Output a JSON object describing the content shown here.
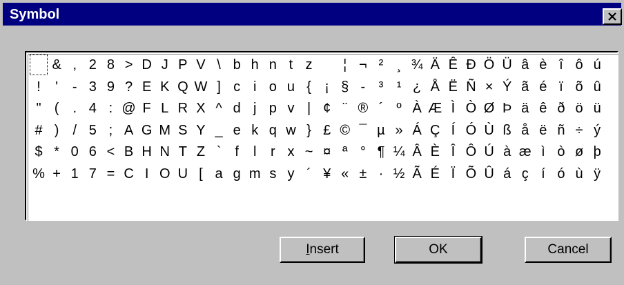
{
  "window": {
    "title": "Symbol",
    "titlebar_color": "#000080"
  },
  "title_buttons": {
    "close_icon": "close-icon"
  },
  "symbol_grid": {
    "selected_index": 0,
    "rows": [
      [
        " ",
        "&",
        ",",
        "2",
        "8",
        ">",
        "D",
        "J",
        "P",
        "V",
        "\\",
        "b",
        "h",
        "n",
        "t",
        "z",
        " ",
        "¦",
        "¬",
        "²",
        "¸",
        "¾",
        "Ä",
        "Ê",
        "Ð",
        "Ö",
        "Ü",
        "â",
        "è",
        "î",
        "ô",
        "ú"
      ],
      [
        "!",
        "'",
        "-",
        "3",
        "9",
        "?",
        "E",
        "K",
        "Q",
        "W",
        "]",
        "c",
        "i",
        "o",
        "u",
        "{",
        "¡",
        "§",
        "-",
        "³",
        "¹",
        "¿",
        "Å",
        "Ë",
        "Ñ",
        "×",
        "Ý",
        "ã",
        "é",
        "ï",
        "õ",
        "û"
      ],
      [
        "\"",
        "(",
        ".",
        "4",
        ":",
        "@",
        "F",
        "L",
        "R",
        "X",
        "^",
        "d",
        "j",
        "p",
        "v",
        "|",
        "¢",
        "¨",
        "®",
        "´",
        "º",
        "À",
        "Æ",
        "Ì",
        "Ò",
        "Ø",
        "Þ",
        "ä",
        "ê",
        "ð",
        "ö",
        "ü"
      ],
      [
        "#",
        ")",
        "/",
        "5",
        ";",
        "A",
        "G",
        "M",
        "S",
        "Y",
        "_",
        "e",
        "k",
        "q",
        "w",
        "}",
        "£",
        "©",
        "¯",
        "µ",
        "»",
        "Á",
        "Ç",
        "Í",
        "Ó",
        "Ù",
        "ß",
        "å",
        "ë",
        "ñ",
        "÷",
        "ý"
      ],
      [
        "$",
        "*",
        "0",
        "6",
        "<",
        "B",
        "H",
        "N",
        "T",
        "Z",
        "`",
        "f",
        "l",
        "r",
        "x",
        "~",
        "¤",
        "ª",
        "°",
        "¶",
        "¼",
        "Â",
        "È",
        "Î",
        "Ô",
        "Ú",
        "à",
        "æ",
        "ì",
        "ò",
        "ø",
        "þ"
      ],
      [
        "%",
        "+",
        "1",
        "7",
        "=",
        "C",
        "I",
        "O",
        "U",
        "[",
        "a",
        "g",
        "m",
        "s",
        "y",
        "´",
        "¥",
        "«",
        "±",
        "·",
        "½",
        "Ã",
        "É",
        "Ï",
        "Õ",
        "Û",
        "á",
        "ç",
        "í",
        "ó",
        "ù",
        "ÿ"
      ]
    ]
  },
  "buttons": {
    "insert": {
      "label": "Insert",
      "mnemonic": "I",
      "rest": "nsert"
    },
    "ok": {
      "label": "OK"
    },
    "cancel": {
      "label": "Cancel"
    }
  }
}
